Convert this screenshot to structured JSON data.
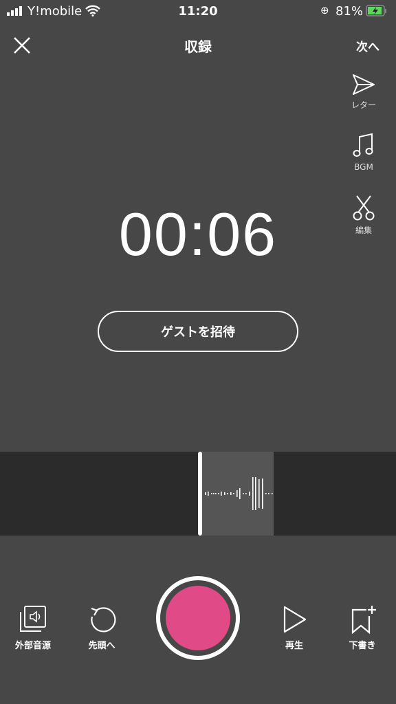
{
  "status": {
    "carrier": "Y!mobile",
    "time": "11:20",
    "battery": "81%"
  },
  "nav": {
    "title": "収録",
    "next": "次へ"
  },
  "side_tools": [
    {
      "label": "レター",
      "icon": "send-icon"
    },
    {
      "label": "BGM",
      "icon": "music-note-icon"
    },
    {
      "label": "編集",
      "icon": "scissors-icon"
    }
  ],
  "timer": "00:06",
  "invite_label": "ゲストを招待",
  "waveform": {
    "levels": [
      2,
      3,
      1,
      1,
      1,
      1,
      3,
      2,
      1,
      2,
      1,
      5,
      8,
      1,
      1,
      3,
      24,
      24,
      21,
      22,
      1,
      1,
      1
    ]
  },
  "bottom": {
    "external": "外部音源",
    "rewind": "先頭へ",
    "play": "再生",
    "draft": "下書き"
  },
  "colors": {
    "record": "#e04a86",
    "background": "#474747",
    "waveform_band": "#2b2b2b"
  }
}
